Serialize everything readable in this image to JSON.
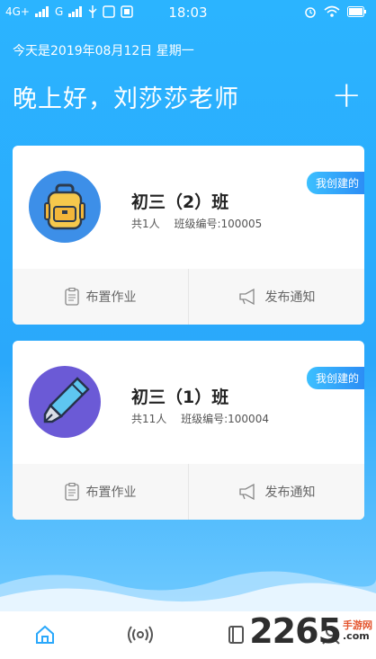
{
  "status_bar": {
    "network1": "4G+",
    "network2": "G",
    "time": "18:03",
    "battery_icon": "battery-icon"
  },
  "header": {
    "date": "今天是2019年08月12日 星期一",
    "greeting": "晚上好，刘莎莎老师",
    "add_icon": "plus-icon"
  },
  "classes": [
    {
      "name": "初三（2）班",
      "members": "共1人",
      "code": "班级编号:100005",
      "badge": "我创建的",
      "avatar_icon": "backpack-icon",
      "action1": "布置作业",
      "action2": "发布通知"
    },
    {
      "name": "初三（1）班",
      "members": "共11人",
      "code": "班级编号:100004",
      "badge": "我创建的",
      "avatar_icon": "pen-icon",
      "action1": "布置作业",
      "action2": "发布通知"
    }
  ],
  "watermark": {
    "big": "2265",
    "small1": "手游网",
    "small2": ".com"
  },
  "colors": {
    "accent": "#2aa8fb",
    "badge": "#3cc0ff"
  }
}
